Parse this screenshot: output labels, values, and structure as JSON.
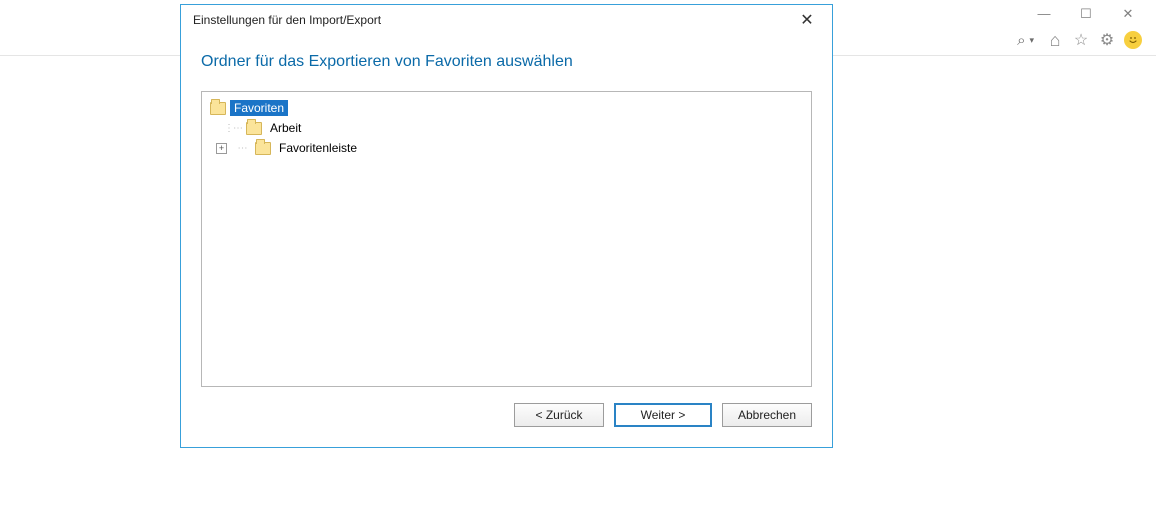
{
  "window_controls": {
    "minimize": "—",
    "maximize": "☐",
    "close": "✕"
  },
  "toolbar": {
    "search_icon": "⌕",
    "dropdown_caret": "▾",
    "home_icon": "⌂",
    "favorites_icon": "☆",
    "settings_icon": "⚙",
    "smiley_icon": "🙂"
  },
  "dialog": {
    "title": "Einstellungen für den Import/Export",
    "close_glyph": "✕",
    "heading": "Ordner für das Exportieren von Favoriten auswählen",
    "tree": {
      "root": {
        "label": "Favoriten",
        "selected": true,
        "expandable": false
      },
      "children": [
        {
          "label": "Arbeit",
          "expandable": false
        },
        {
          "label": "Favoritenleiste",
          "expandable": true
        }
      ]
    },
    "buttons": {
      "back": "< Zurück",
      "next": "Weiter >",
      "cancel": "Abbrechen"
    }
  }
}
